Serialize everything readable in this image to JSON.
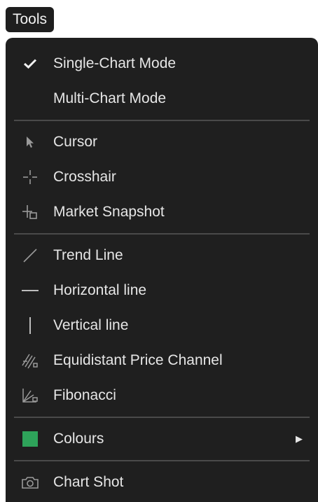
{
  "tools_button": {
    "label": "Tools"
  },
  "menu": {
    "modes": [
      {
        "label": "Single-Chart Mode",
        "checked": true,
        "icon": "check-icon"
      },
      {
        "label": "Multi-Chart Mode",
        "checked": false
      }
    ],
    "pointers": [
      {
        "label": "Cursor",
        "icon": "cursor-icon"
      },
      {
        "label": "Crosshair",
        "icon": "crosshair-icon"
      },
      {
        "label": "Market Snapshot",
        "icon": "market-snapshot-icon"
      }
    ],
    "drawing": [
      {
        "label": "Trend Line",
        "icon": "trend-line-icon"
      },
      {
        "label": "Horizontal line",
        "icon": "horizontal-line-icon"
      },
      {
        "label": "Vertical line",
        "icon": "vertical-line-icon"
      },
      {
        "label": "Equidistant Price Channel",
        "icon": "price-channel-icon"
      },
      {
        "label": "Fibonacci",
        "icon": "fibonacci-icon"
      }
    ],
    "colours": {
      "label": "Colours",
      "swatch_color": "#2ea35a",
      "has_submenu": true
    },
    "chart_shot": {
      "label": "Chart Shot",
      "icon": "camera-icon"
    }
  },
  "colors": {
    "menu_bg": "#1f1f1f",
    "text": "#e6e6e6",
    "separator": "#4a4a4a"
  }
}
